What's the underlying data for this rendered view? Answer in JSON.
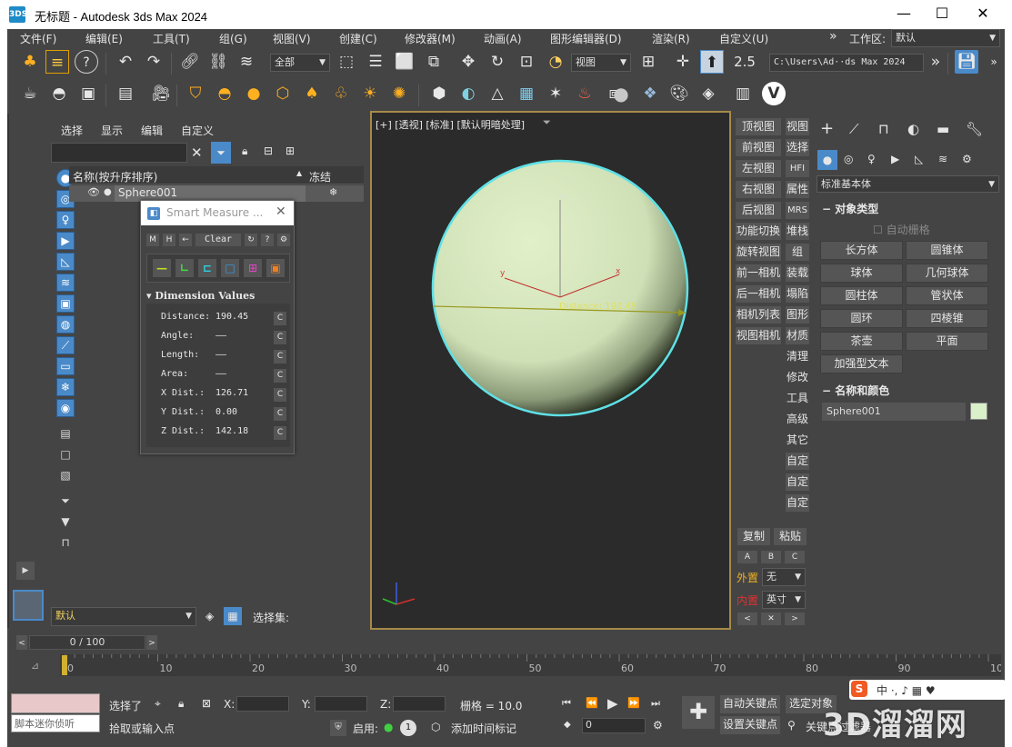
{
  "window": {
    "title": "无标题 - Autodesk 3ds Max 2024",
    "app_logo": "3DS",
    "minimize": "—",
    "maximize": "☐",
    "close": "✕"
  },
  "menu": [
    "文件(F)",
    "编辑(E)",
    "工具(T)",
    "组(G)",
    "视图(V)",
    "创建(C)",
    "修改器(M)",
    "动画(A)",
    "图形编辑器(D)",
    "渲染(R)",
    "自定义(U)"
  ],
  "workspace": {
    "label": "工作区:",
    "value": "默认"
  },
  "toolbar": {
    "selection_filter": "全部",
    "ref_coord": "视图",
    "path": "C:\\Users\\Ad··ds Max 2024",
    "snap_value": "2.5"
  },
  "scene_explorer": {
    "tabs": [
      "选择",
      "显示",
      "编辑",
      "自定义"
    ],
    "col_name": "名称(按升序排序)",
    "col_freeze": "冻结",
    "rows": [
      {
        "name": "Sphere001"
      }
    ],
    "layer": "默认",
    "selection_set": "选择集:"
  },
  "viewport": {
    "label": "[+] [透视] [标准] [默认明暗处理]",
    "distance_label": "Distance: 190.45",
    "axis_z": "z",
    "axis_y": "y",
    "axis_x": "x"
  },
  "viewport_tools": {
    "col1": [
      "顶视图",
      "前视图",
      "左视图",
      "右视图",
      "后视图",
      "功能切换",
      "旋转视图",
      "前一相机",
      "后一相机",
      "相机列表",
      "视图相机"
    ],
    "col2": [
      "视图",
      "选择",
      "HFI",
      "属性",
      "MRS",
      "堆栈",
      "组",
      "装载",
      "塌陷",
      "图形",
      "材质",
      "清理",
      "修改",
      "工具",
      "高级",
      "其它",
      "自定",
      "自定",
      "自定"
    ],
    "copy": "复制",
    "paste": "粘贴",
    "abc": [
      "A",
      "B",
      "C"
    ],
    "outer_label": "外置",
    "outer_value": "无",
    "inner_label": "内置",
    "inner_value": "英寸"
  },
  "command_panel": {
    "category": "标准基本体",
    "rollout1": "对象类型",
    "autogrid": "自动栅格",
    "objects": [
      "长方体",
      "圆锥体",
      "球体",
      "几何球体",
      "圆柱体",
      "管状体",
      "圆环",
      "四棱锥",
      "茶壶",
      "平面",
      "加强型文本"
    ],
    "rollout2": "名称和颜色",
    "object_name": "Sphere001",
    "object_color": "#d9f0c8"
  },
  "smart_measure": {
    "title": "Smart Measure ...",
    "buttons": [
      "M",
      "H",
      "←",
      "Clear",
      "↻",
      "?",
      "⚙"
    ],
    "section": "Dimension Values",
    "rows": [
      {
        "label": "Distance:",
        "value": "190.45"
      },
      {
        "label": "Angle:",
        "value": "——"
      },
      {
        "label": "Length:",
        "value": "——"
      },
      {
        "label": "Area:",
        "value": "——"
      },
      {
        "label": "X Dist.:",
        "value": "126.71"
      },
      {
        "label": "Y Dist.:",
        "value": "0.00"
      },
      {
        "label": "Z Dist.:",
        "value": "142.18"
      }
    ],
    "copy_btn": "C"
  },
  "timeline": {
    "frame": "0 / 100",
    "ticks": [
      "0",
      "10",
      "20",
      "30",
      "40",
      "50",
      "60",
      "70",
      "80",
      "90",
      "100"
    ]
  },
  "status": {
    "maxscript_placeholder": "脚本迷你侦听",
    "selected": "选择了",
    "prompt": "拾取或输入点",
    "x": "X:",
    "y": "Y:",
    "z": "Z:",
    "grid": "栅格 = 10.0",
    "enable": "启用:",
    "add_time_tag": "添加时间标记",
    "auto_key": "自动关键点",
    "set_key": "设置关键点",
    "select_object": "选定对象",
    "key_filter": "关键点过滤器",
    "frame_value": "0"
  },
  "ime": {
    "text": "中 ·, ♪ ▦ ♥"
  },
  "watermark": "3D溜溜网",
  "colors": {
    "accent": "#4a8ac9",
    "frame_border": "#a58a48",
    "sphere": "#d9ecc0",
    "selection": "#5fe0e6"
  }
}
